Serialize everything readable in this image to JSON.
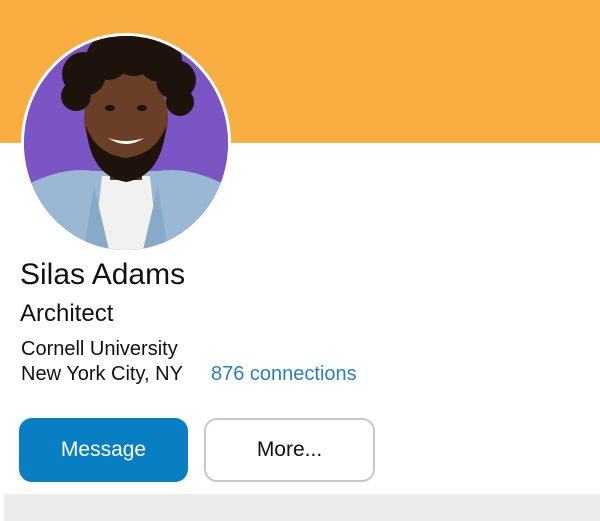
{
  "profile": {
    "name": "Silas Adams",
    "headline": "Architect",
    "school": "Cornell University",
    "location": "New York City, NY",
    "connections": "876 connections"
  },
  "actions": {
    "message_label": "Message",
    "more_label": "More..."
  },
  "colors": {
    "banner": "#f9ae42",
    "primary_button": "#0a7ec2",
    "link": "#2a7fc0",
    "avatar_background": "#7b55c4"
  }
}
